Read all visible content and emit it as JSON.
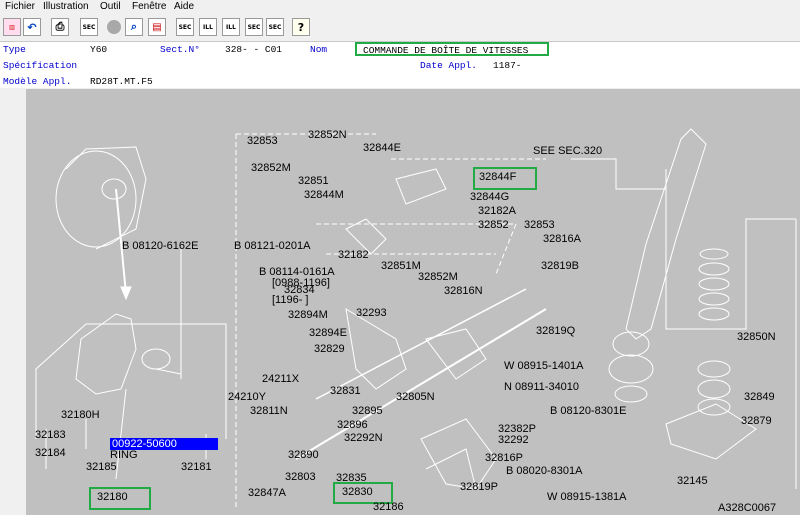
{
  "menu": [
    "Fichier",
    "Illustration",
    "Outil",
    "Fenêtre",
    "Aide"
  ],
  "toolbar": {
    "buttons": [
      "print",
      "undo",
      "printer",
      "SEC",
      "circle",
      "search",
      "book",
      "SEC-prev",
      "ILL-first",
      "ILL-next",
      "SEC-next",
      "SEC-refresh",
      "help"
    ]
  },
  "info": {
    "type_label": "Type",
    "type_value": "Y60",
    "sect_label": "Sect.N°",
    "sect_value": "328-  - C01",
    "nom_label": "Nom",
    "nom_value": "COMMANDE DE BOÎTE DE VITESSES",
    "spec_label": "Spécification",
    "date_label": "Date Appl.",
    "date_value": "1187-",
    "model_label": "Modèle Appl.",
    "model_value": "RD28T.MT.F5"
  },
  "diagram": {
    "see_sec": "SEE SEC.320",
    "ref_code": "A328C0067",
    "highlighted_code": "00922-50600",
    "ring": "RING",
    "parts": [
      "32853",
      "32852N",
      "32844E",
      "32852M",
      "32851",
      "32844M",
      "32844F",
      "32844G",
      "32182A",
      "32852",
      "32853",
      "32816A",
      "32182",
      "32851M",
      "32819B",
      "32852M",
      "32816N",
      "32834",
      "32293",
      "32894M",
      "32894E",
      "32829",
      "32819Q",
      "32850N",
      "24211X",
      "32831",
      "08915-1401A",
      "08911-34010",
      "32805N",
      "32849",
      "24210Y",
      "32811N",
      "32895",
      "08120-8301E",
      "32879",
      "32896",
      "32382P",
      "32292N",
      "32292",
      "32890",
      "32816P",
      "32803",
      "08020-8301A",
      "32145",
      "32835",
      "32847A",
      "32830",
      "32819P",
      "08915-1381A",
      "32186",
      "32183",
      "32180H",
      "32184",
      "32185",
      "32181",
      "32180",
      "08120-6162E",
      "08121-0201A",
      "08114-0161A"
    ],
    "bolt_prefix": "B",
    "washer_prefix": "W",
    "nut_prefix": "N",
    "bolt_1": "08120-6162E",
    "bolt_2": "08121-0201A",
    "bolt_3": "08114-0161A",
    "range_1": "[0988-1196]",
    "range_2": "[1196-       ]"
  }
}
